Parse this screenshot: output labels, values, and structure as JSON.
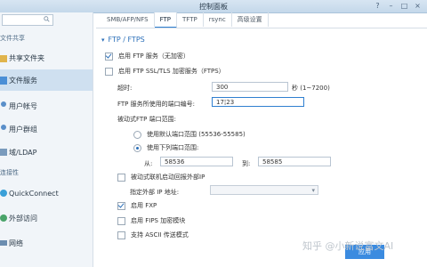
{
  "window": {
    "title": "控制面板"
  },
  "sidebar": {
    "search_placeholder": "",
    "items": [
      {
        "label": "文件共享",
        "section": true
      },
      {
        "label": "共享文件夹",
        "icon": "folder-icon"
      },
      {
        "label": "文件服务",
        "icon": "file-services-icon",
        "active": true
      },
      {
        "label": "用户帐号",
        "icon": "user-icon"
      },
      {
        "label": "用户群组",
        "icon": "group-icon"
      },
      {
        "label": "域/LDAP",
        "icon": "domain-icon"
      },
      {
        "label": "连接性",
        "section": true
      },
      {
        "label": "QuickConnect",
        "icon": "quickconnect-icon"
      },
      {
        "label": "外部访问",
        "icon": "globe-icon"
      },
      {
        "label": "网络",
        "icon": "network-icon"
      }
    ]
  },
  "tabs": [
    "SMB/AFP/NFS",
    "FTP",
    "TFTP",
    "rsync",
    "高级设置"
  ],
  "active_tab": "FTP",
  "section_title": "FTP / FTPS",
  "form": {
    "enable_ftp": "启用 FTP 服务（无加密）",
    "enable_ftps": "启用 FTP SSL/TLS 加密服务（FTPS）",
    "timeout_label": "超时:",
    "timeout_value": "300",
    "timeout_suffix": "秒 (1~7200)",
    "port_label": "FTP 服务所使用的端口编号:",
    "port_value": "17¦23",
    "passive_label": "被动式FTP 端口范围:",
    "radio_default": "使用默认端口范围 (55536-55585)",
    "radio_custom": "使用下列端口范围:",
    "from_label": "从:",
    "from_value": "58536",
    "to_label": "到:",
    "to_value": "58585",
    "report_ip": "被动式联机启动回报外部IP",
    "external_ip_label": "指定外部 IP 地址:",
    "enable_fxp": "启用 FXP",
    "enable_fips": "启用 FIPS 加密模块",
    "ascii_mode": "支持 ASCII 传送模式"
  },
  "checks": {
    "enable_ftp": true,
    "enable_ftps": false,
    "report_ip": false,
    "enable_fxp": true,
    "enable_fips": false,
    "ascii_mode": false
  },
  "apply_label": "应用",
  "watermark": "知乎 @小新说富文AI"
}
